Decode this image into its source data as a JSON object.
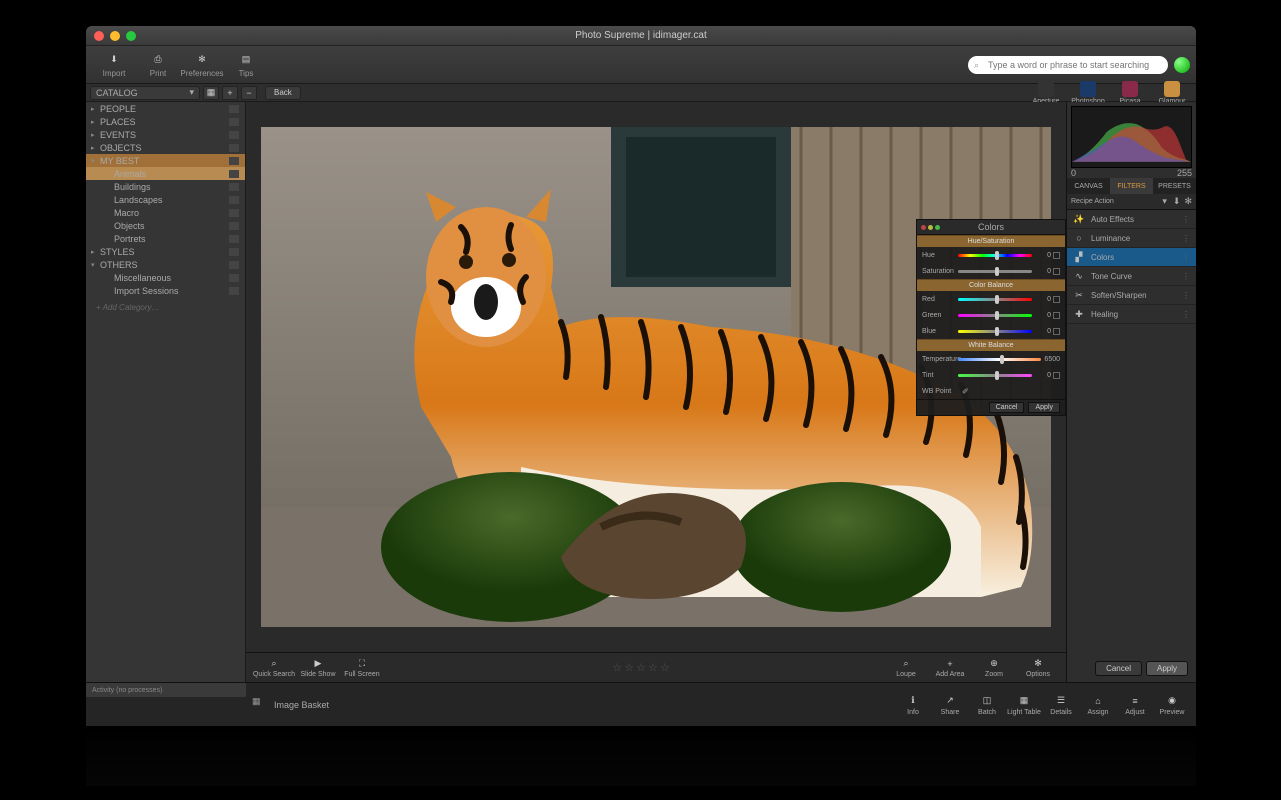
{
  "window_title": "Photo Supreme | idimager.cat",
  "toolbar": [
    {
      "name": "import-button",
      "label": "Import",
      "icon": "download"
    },
    {
      "name": "print-button",
      "label": "Print",
      "icon": "printer"
    },
    {
      "name": "preferences-button",
      "label": "Preferences",
      "icon": "gear"
    },
    {
      "name": "tips-button",
      "label": "Tips",
      "icon": "note"
    }
  ],
  "search_placeholder": "Type a word or phrase to start searching",
  "catalog": {
    "dropdown": "CATALOG",
    "back": "Back"
  },
  "ext_apps": [
    {
      "name": "aperture-app",
      "label": "Aperture",
      "color": "#333"
    },
    {
      "name": "photoshop-app",
      "label": "Photoshop",
      "color": "#1a3a6a"
    },
    {
      "name": "picasa-app",
      "label": "Picasa",
      "color": "#8a2a4a"
    },
    {
      "name": "glamour-app",
      "label": "Glamour",
      "color": "#c89040"
    }
  ],
  "sidebar": {
    "cats": [
      {
        "label": "PEOPLE"
      },
      {
        "label": "PLACES"
      },
      {
        "label": "EVENTS"
      },
      {
        "label": "OBJECTS"
      },
      {
        "label": "MY BEST",
        "selected": true,
        "expanded": true,
        "subs": [
          {
            "label": "Animals",
            "selected": true
          },
          {
            "label": "Buildings"
          },
          {
            "label": "Landscapes"
          },
          {
            "label": "Macro"
          },
          {
            "label": "Objects"
          },
          {
            "label": "Portrets"
          }
        ]
      },
      {
        "label": "STYLES"
      },
      {
        "label": "OTHERS",
        "expanded": true,
        "subs": [
          {
            "label": "Miscellaneous"
          },
          {
            "label": "Import Sessions"
          }
        ]
      }
    ],
    "add": "+ Add Category…"
  },
  "colors_panel": {
    "title": "Colors",
    "s1": "Hue/Saturation",
    "hue": {
      "label": "Hue",
      "value": "0"
    },
    "sat": {
      "label": "Saturation",
      "value": "0"
    },
    "s2": "Color Balance",
    "red": {
      "label": "Red",
      "value": "0"
    },
    "green": {
      "label": "Green",
      "value": "0"
    },
    "blue": {
      "label": "Blue",
      "value": "0"
    },
    "s3": "White Balance",
    "temp": {
      "label": "Temperature",
      "value": "6500"
    },
    "tint": {
      "label": "Tint",
      "value": "0"
    },
    "wbpoint": "WB Point",
    "cancel": "Cancel",
    "apply": "Apply"
  },
  "viewer_bar": {
    "left": [
      {
        "name": "quick-search-button",
        "label": "Quick Search",
        "icon": "search"
      },
      {
        "name": "slideshow-button",
        "label": "Slide Show",
        "icon": "play"
      },
      {
        "name": "fullscreen-button",
        "label": "Full Screen",
        "icon": "expand"
      }
    ],
    "right": [
      {
        "name": "loupe-button",
        "label": "Loupe",
        "icon": "search"
      },
      {
        "name": "add-area-button",
        "label": "Add Area",
        "icon": "plus"
      },
      {
        "name": "zoom-button",
        "label": "Zoom",
        "icon": "zoom"
      },
      {
        "name": "options-button",
        "label": "Options",
        "icon": "gear"
      }
    ]
  },
  "right": {
    "histo_labels": [
      "0",
      "255"
    ],
    "tabs": [
      {
        "label": "CANVAS"
      },
      {
        "label": "FILTERS",
        "active": true
      },
      {
        "label": "PRESETS"
      }
    ],
    "recipe": "Recipe Action",
    "filters": [
      {
        "name": "auto-effects-filter",
        "label": "Auto Effects",
        "icon": "wand"
      },
      {
        "name": "luminance-filter",
        "label": "Luminance",
        "icon": "sun"
      },
      {
        "name": "colors-filter",
        "label": "Colors",
        "icon": "palette",
        "active": true
      },
      {
        "name": "tone-curve-filter",
        "label": "Tone Curve",
        "icon": "curve"
      },
      {
        "name": "soften-sharpen-filter",
        "label": "Soften/Sharpen",
        "icon": "tools"
      },
      {
        "name": "healing-filter",
        "label": "Healing",
        "icon": "bandage"
      }
    ]
  },
  "footer": {
    "activity": "Activity (no processes)",
    "basket": "Image Basket",
    "actions": [
      {
        "name": "info-action",
        "label": "Info",
        "icon": "info"
      },
      {
        "name": "share-action",
        "label": "Share",
        "icon": "share"
      },
      {
        "name": "batch-action",
        "label": "Batch",
        "icon": "cube"
      },
      {
        "name": "light-table-action",
        "label": "Light Table",
        "icon": "grid"
      },
      {
        "name": "details-action",
        "label": "Details",
        "icon": "list"
      },
      {
        "name": "assign-action",
        "label": "Assign",
        "icon": "tag"
      },
      {
        "name": "adjust-action",
        "label": "Adjust",
        "icon": "sliders"
      },
      {
        "name": "preview-action",
        "label": "Preview",
        "icon": "eye"
      }
    ]
  },
  "apply_row": {
    "cancel": "Cancel",
    "apply": "Apply"
  }
}
